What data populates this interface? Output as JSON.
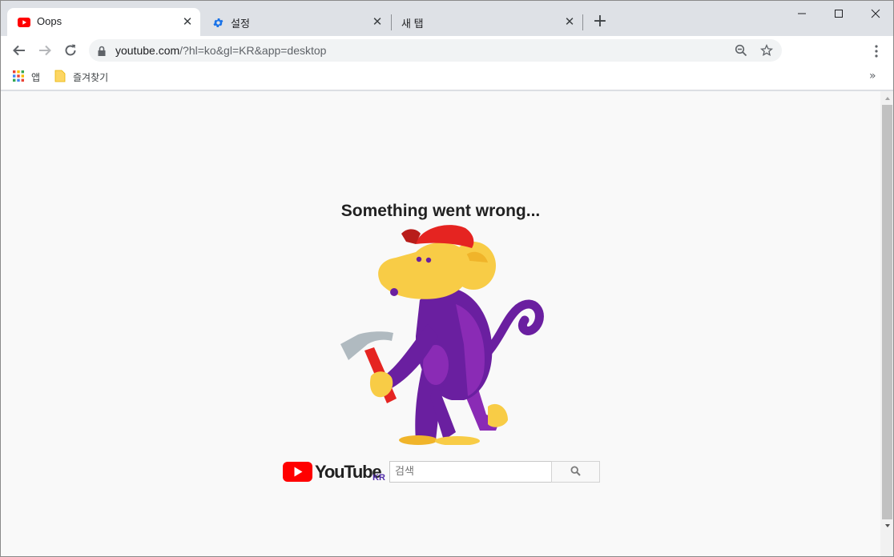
{
  "colors": {
    "youtube_red": "#ff0000",
    "settings_blue": "#1a73e8",
    "monkey_purple": "#6a1fa0",
    "monkey_yellow": "#f8cc46",
    "cap_red": "#e52421",
    "kr_purple": "#512da8"
  },
  "tabs": [
    {
      "title": "Oops",
      "icon": "youtube-icon",
      "active": true
    },
    {
      "title": "설정",
      "icon": "gear-icon",
      "active": false
    },
    {
      "title": "새 탭",
      "icon": "",
      "active": false
    }
  ],
  "toolbar": {
    "url_host": "youtube.com",
    "url_path": "/?hl=ko&gl=KR&app=desktop"
  },
  "bookmarks": [
    {
      "label": "앱",
      "icon": "apps-grid-icon"
    },
    {
      "label": "즐겨찾기",
      "icon": "folder-icon"
    }
  ],
  "page": {
    "heading": "Something went wrong...",
    "logo_region": "KR",
    "search_placeholder": "검색"
  }
}
